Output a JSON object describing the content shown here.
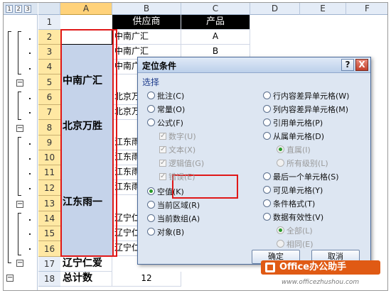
{
  "outline": {
    "levels": [
      "1",
      "2",
      "3"
    ]
  },
  "columns": [
    "A",
    "B",
    "C",
    "D",
    "E",
    "F"
  ],
  "rows": [
    "1",
    "2",
    "3",
    "4",
    "5",
    "6",
    "7",
    "8",
    "9",
    "10",
    "11",
    "12",
    "13",
    "14",
    "15",
    "16",
    "17",
    "18"
  ],
  "table": {
    "header": {
      "supplier": "供应商",
      "product": "产品"
    },
    "groups": {
      "g1": "中南广汇",
      "g2": "北京万胜",
      "g3": "江东雨一"
    },
    "b": {
      "r2": "中南广汇",
      "r3": "中南广汇",
      "r4": "中南广",
      "r6": "北京万",
      "r7": "北京万",
      "r9": "江东雨",
      "r10": "江东雨",
      "r11": "江东雨",
      "r12": "江东雨",
      "r14": "辽宁仁",
      "r15": "辽宁仁",
      "r16": "辽宁仁"
    },
    "c": {
      "r2": "A",
      "r3": "B"
    },
    "row17_a": "辽宁仁爱",
    "row18_a": "总计数",
    "row18_b": "12"
  },
  "dialog": {
    "title": "定位条件",
    "help": "?",
    "close": "X",
    "section": "选择",
    "left": [
      {
        "label": "批注(C)",
        "state": "normal"
      },
      {
        "label": "常量(O)",
        "state": "normal"
      },
      {
        "label": "公式(F)",
        "state": "normal"
      },
      {
        "label": "数字(U)",
        "state": "check-disabled-on"
      },
      {
        "label": "文本(X)",
        "state": "check-disabled-on"
      },
      {
        "label": "逻辑值(G)",
        "state": "check-disabled-on"
      },
      {
        "label": "错误(E)",
        "state": "check-disabled-on"
      },
      {
        "label": "空值(K)",
        "state": "selected"
      },
      {
        "label": "当前区域(R)",
        "state": "normal"
      },
      {
        "label": "当前数组(A)",
        "state": "normal"
      },
      {
        "label": "对象(B)",
        "state": "normal"
      }
    ],
    "right": [
      {
        "label": "行内容差异单元格(W)",
        "state": "normal"
      },
      {
        "label": "列内容差异单元格(M)",
        "state": "normal"
      },
      {
        "label": "引用单元格(P)",
        "state": "normal"
      },
      {
        "label": "从属单元格(D)",
        "state": "normal"
      },
      {
        "label": "直属(I)",
        "state": "radio-disabled-on"
      },
      {
        "label": "所有级别(L)",
        "state": "radio-disabled"
      },
      {
        "label": "最后一个单元格(S)",
        "state": "normal"
      },
      {
        "label": "可见单元格(Y)",
        "state": "normal"
      },
      {
        "label": "条件格式(T)",
        "state": "normal"
      },
      {
        "label": "数据有效性(V)",
        "state": "normal"
      },
      {
        "label": "全部(L)",
        "state": "radio-disabled-on"
      },
      {
        "label": "相同(E)",
        "state": "radio-disabled"
      }
    ],
    "ok": "确定",
    "cancel": "取消"
  },
  "watermark": {
    "brand": "Office办公助手",
    "url": "www.officezhushou.com"
  },
  "colors": {
    "selection": "#c5d3ea",
    "highlight": "#e01818",
    "brand": "#e05a14"
  }
}
